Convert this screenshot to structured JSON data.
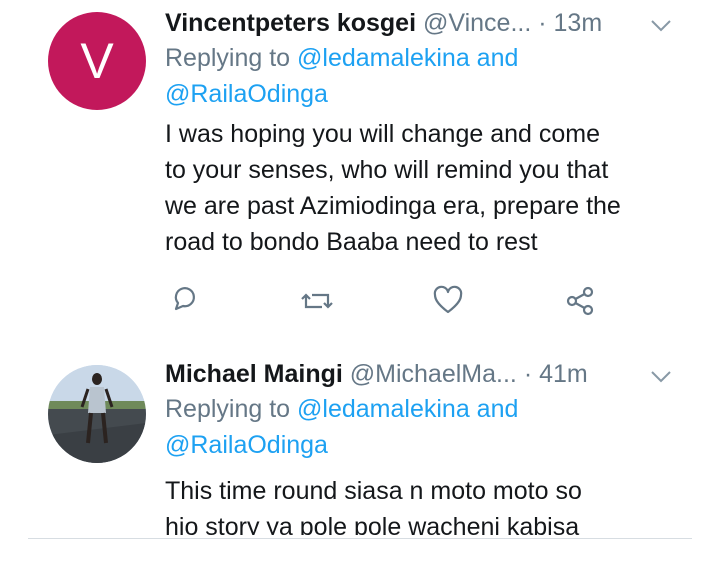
{
  "tweets": [
    {
      "avatar_letter": "V",
      "avatar_color": "#c2185b",
      "name": "Vincentpeters kosgei",
      "handle": "@Vince...",
      "time": "· 13m",
      "replying_label": "Replying to",
      "replying_to_1": "@ledamalekina and",
      "replying_to_2": "@RailaOdinga",
      "text_lines": [
        "I was hoping you will  change and  come",
        "to your senses, who will remind you that",
        "we are past Azimiodinga era, prepare the",
        "road to bondo Baaba need to rest"
      ],
      "actions": [
        "reply-icon",
        "retweet-icon",
        "like-icon",
        "share-icon"
      ]
    },
    {
      "name": "Michael Maingi",
      "handle": "@MichaelMa...",
      "time": "· 41m",
      "replying_label": "Replying to",
      "replying_to_1": "@ledamalekina and",
      "replying_to_2": "@RailaOdinga",
      "text_lines": [
        "This time round siasa n moto moto so",
        "hio story ya pole pole wacheni kabisa"
      ]
    }
  ],
  "colors": {
    "link": "#1da1f2",
    "muted": "#657786",
    "text": "#14171a"
  }
}
